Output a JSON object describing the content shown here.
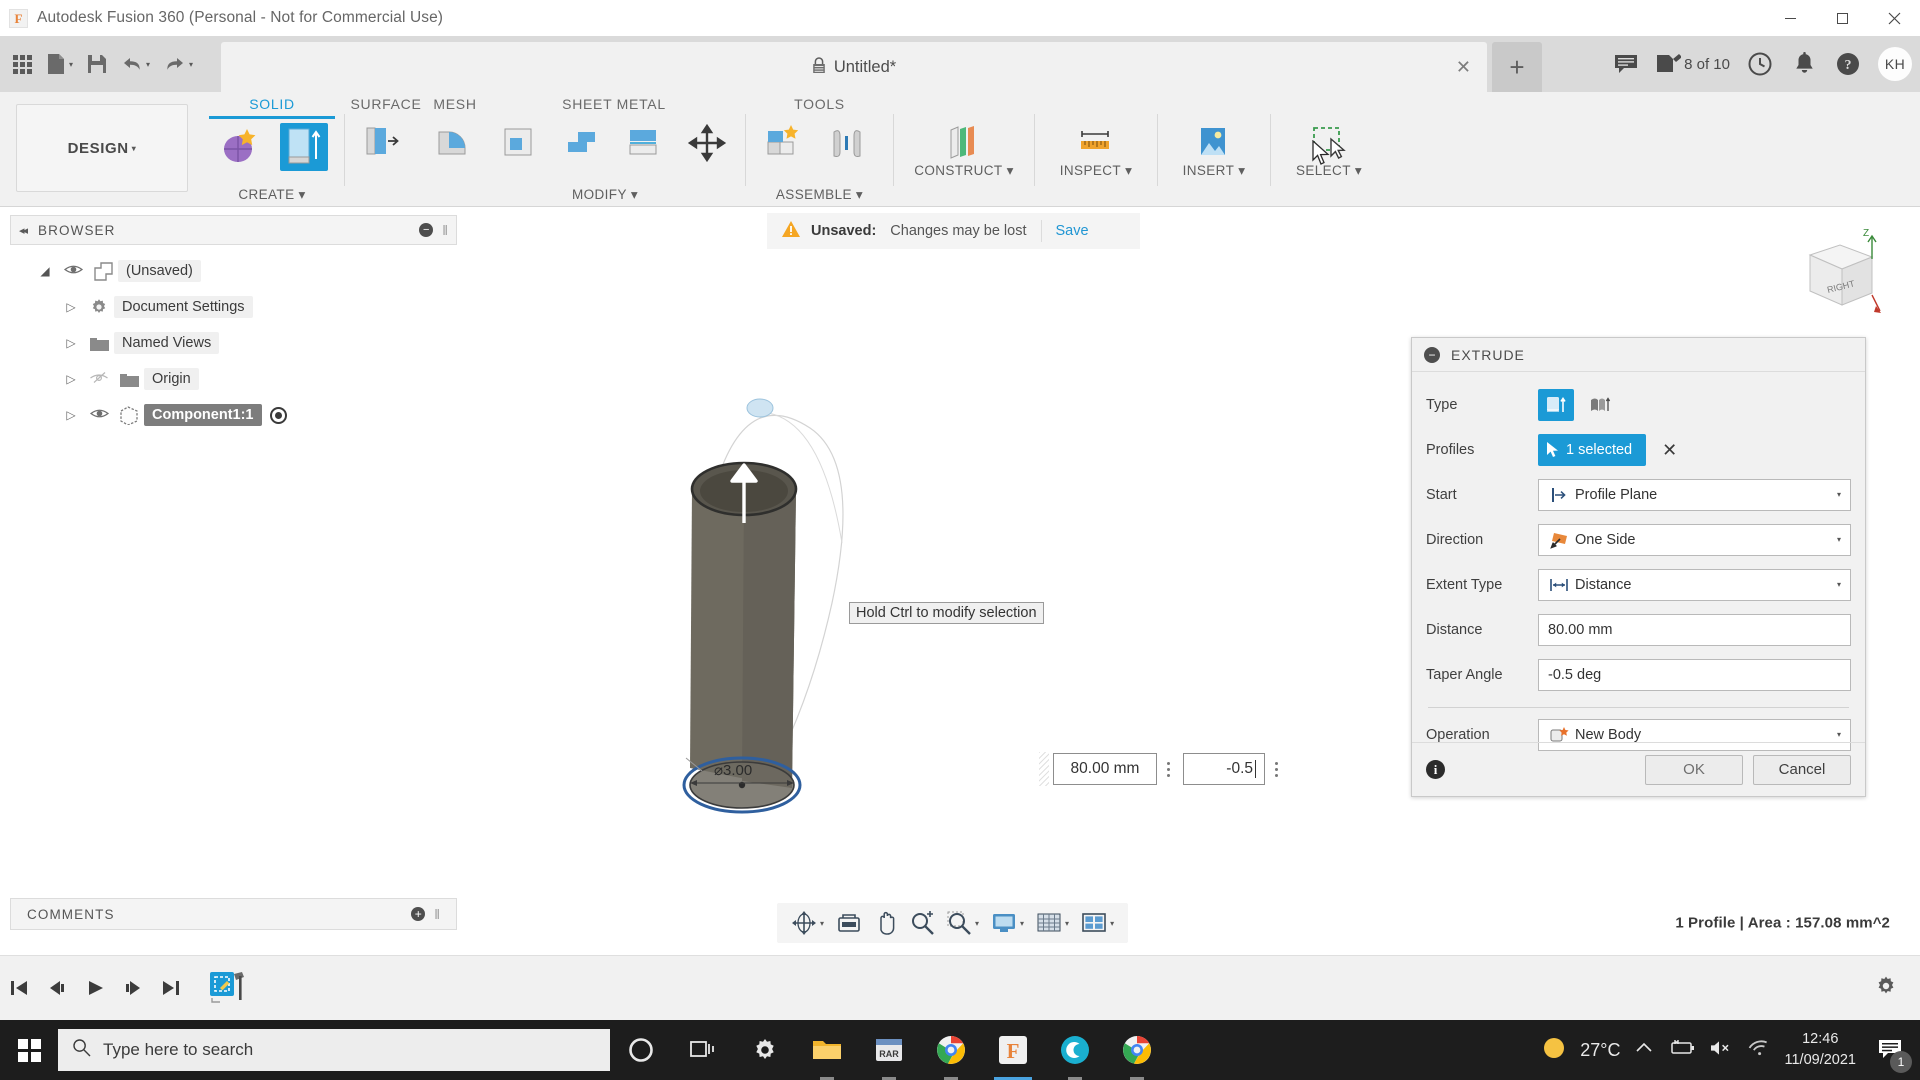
{
  "window": {
    "title": "Autodesk Fusion 360 (Personal - Not for Commercial Use)",
    "logo_letter": "F",
    "minimize": "—",
    "maximize": "❐",
    "close": "✕"
  },
  "quickaccess": {
    "grid_icon": "apps-grid-icon",
    "file_icon": "file-icon",
    "save_icon": "save-icon",
    "undo_icon": "undo-icon",
    "redo_icon": "redo-icon",
    "caret": "▾",
    "tab": {
      "lock_icon": "lock-icon",
      "name": "Untitled*",
      "close": "✕"
    },
    "new_tab": "+",
    "right_icons": [
      {
        "name": "comments-icon",
        "label": ""
      },
      {
        "name": "jobs-status-icon",
        "label": "8 of 10"
      },
      {
        "name": "recent-activity-icon",
        "label": ""
      },
      {
        "name": "notifications-bell-icon",
        "label": ""
      },
      {
        "name": "help-icon",
        "label": ""
      }
    ],
    "avatar_initials": "KH"
  },
  "ribbon": {
    "workspace": "DESIGN",
    "workspace_caret": "▾",
    "tabs": [
      {
        "label": "SOLID",
        "active": true
      },
      {
        "label": "SURFACE",
        "active": false
      },
      {
        "label": "MESH",
        "active": false
      },
      {
        "label": "SHEET METAL",
        "active": false
      },
      {
        "label": "TOOLS",
        "active": false
      }
    ],
    "groups": [
      {
        "label": "CREATE",
        "caret": "▾"
      },
      {
        "label": "MODIFY",
        "caret": "▾"
      },
      {
        "label": "ASSEMBLE",
        "caret": "▾"
      },
      {
        "label": "CONSTRUCT",
        "caret": "▾"
      },
      {
        "label": "INSPECT",
        "caret": "▾"
      },
      {
        "label": "INSERT",
        "caret": "▾"
      },
      {
        "label": "SELECT",
        "caret": "▾"
      }
    ]
  },
  "browser": {
    "title": "BROWSER",
    "collapse_arrows": "◂◂",
    "minus": "−",
    "grip": "‖",
    "items": [
      {
        "label": "(Unsaved)",
        "icon": "document-icon",
        "expander": "◢",
        "eye": "visible",
        "indent": 0,
        "selected": false
      },
      {
        "label": "Document Settings",
        "icon": "gear-icon",
        "expander": "▷",
        "eye": "none",
        "indent": 1,
        "selected": false
      },
      {
        "label": "Named Views",
        "icon": "folder-icon",
        "expander": "▷",
        "eye": "none",
        "indent": 1,
        "selected": false
      },
      {
        "label": "Origin",
        "icon": "folder-icon",
        "expander": "▷",
        "eye": "hidden",
        "indent": 1,
        "selected": false
      },
      {
        "label": "Component1:1",
        "icon": "component-icon",
        "expander": "▷",
        "eye": "visible",
        "indent": 1,
        "selected": true
      }
    ]
  },
  "viewport": {
    "unsaved": {
      "warn_icon": "warning-icon",
      "label": "Unsaved:",
      "message": "Changes may be lost",
      "save_link": "Save"
    },
    "tooltip": "Hold Ctrl to modify selection",
    "inline_distance": "80.00 mm",
    "inline_taper": "-0.5",
    "dimension_label": "⌀3.00",
    "viewcube": {
      "z_label": "Z",
      "face_label": "RIGHT"
    }
  },
  "extrude": {
    "title": "EXTRUDE",
    "collapse": "−",
    "rows": [
      {
        "key": "type",
        "label": "Type"
      },
      {
        "key": "profiles",
        "label": "Profiles",
        "value": "1 selected",
        "clear": "✕"
      },
      {
        "key": "start",
        "label": "Start",
        "value": "Profile Plane",
        "icon": "profile-plane-icon"
      },
      {
        "key": "direction",
        "label": "Direction",
        "value": "One Side",
        "icon": "one-side-icon"
      },
      {
        "key": "extent_type",
        "label": "Extent Type",
        "value": "Distance",
        "icon": "distance-icon"
      },
      {
        "key": "distance",
        "label": "Distance",
        "value": "80.00 mm"
      },
      {
        "key": "taper_angle",
        "label": "Taper Angle",
        "value": "-0.5 deg"
      },
      {
        "key": "operation",
        "label": "Operation",
        "value": "New Body",
        "icon": "new-body-icon"
      }
    ],
    "dropdown_arrow": "▾",
    "info": "i",
    "ok": "OK",
    "cancel": "Cancel"
  },
  "navbar": {
    "tools": [
      {
        "name": "orbit-icon",
        "caret": "▾"
      },
      {
        "name": "display-settings-icon",
        "caret": ""
      },
      {
        "name": "pan-icon",
        "caret": ""
      },
      {
        "name": "zoom-icon",
        "caret": ""
      },
      {
        "name": "fit-icon",
        "caret": "▾"
      },
      {
        "name": "display-mode-icon",
        "caret": "▾"
      },
      {
        "name": "grid-snap-icon",
        "caret": "▾"
      },
      {
        "name": "viewports-icon",
        "caret": "▾"
      }
    ],
    "status": "1 Profile | Area : 157.08 mm^2"
  },
  "comments": {
    "title": "COMMENTS",
    "plus": "+",
    "grip": "‖"
  },
  "timeline": {
    "buttons": [
      "⏮",
      "⏴",
      "▶",
      "⏵",
      "⏭"
    ],
    "node": "sketch-node-icon",
    "settings": "gear-icon"
  },
  "taskbar": {
    "start": "windows-start-icon",
    "search_placeholder": "Type here to search",
    "search_icon": "search-icon",
    "apps": [
      {
        "name": "cortana-icon",
        "state": ""
      },
      {
        "name": "task-view-icon",
        "state": ""
      },
      {
        "name": "settings-icon",
        "state": ""
      },
      {
        "name": "file-explorer-icon",
        "state": "running"
      },
      {
        "name": "winrar-icon",
        "state": "running"
      },
      {
        "name": "chrome-icon",
        "state": "running"
      },
      {
        "name": "fusion360-icon",
        "state": "active"
      },
      {
        "name": "cisco-webex-icon",
        "state": "running"
      },
      {
        "name": "chrome-2-icon",
        "state": "running"
      }
    ],
    "tray": {
      "weather_icon": "sun-icon",
      "temperature": "27°C",
      "chevron": "⌃",
      "battery_icon": "battery-charging-icon",
      "volume_icon": "volume-muted-icon",
      "network_icon": "wifi-icon",
      "time": "12:46",
      "date": "11/09/2021",
      "notification_icon": "action-center-icon",
      "notification_count": "1"
    }
  },
  "colors": {
    "accent_blue": "#1b9ad6",
    "ribbon_bg": "#f1f1f1",
    "qabar_bg": "#dadada",
    "taskbar_bg": "#1d1d1d",
    "warn_orange": "#f5a623",
    "model_gray": "#6e6a5f"
  }
}
